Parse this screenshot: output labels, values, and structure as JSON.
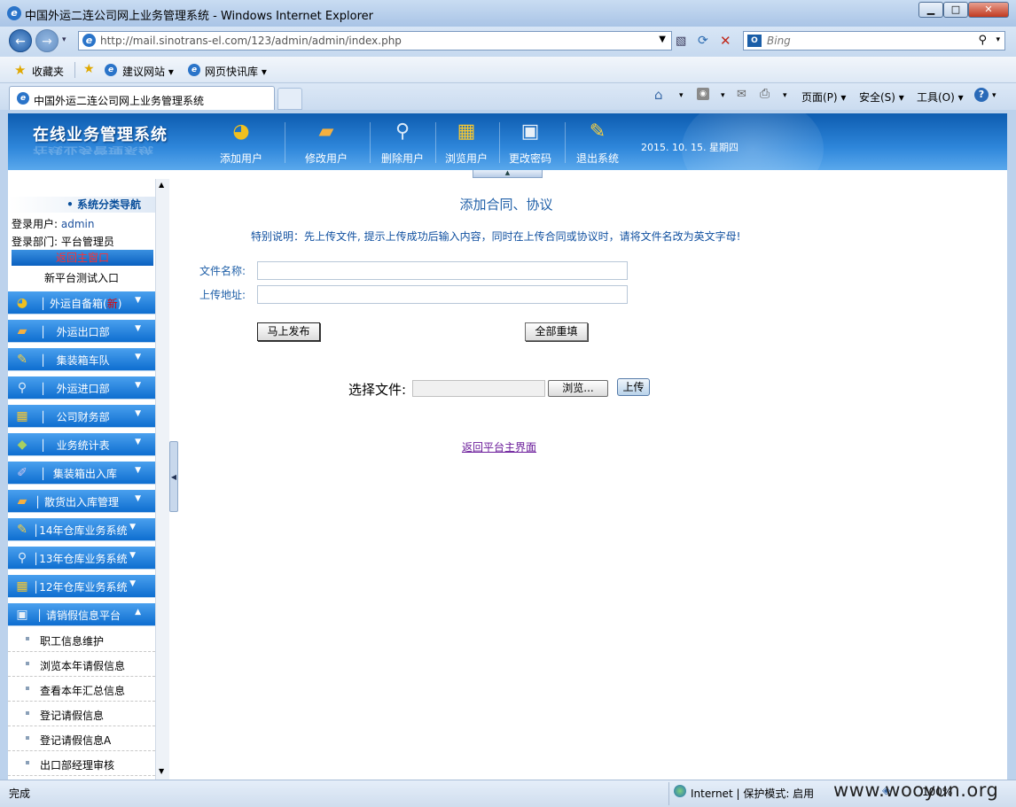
{
  "window": {
    "title": "中国外运二连公司网上业务管理系统 - Windows Internet Explorer"
  },
  "address": {
    "url": "http://mail.sinotrans-el.com/123/admin/admin/index.php",
    "search_placeholder": "Bing"
  },
  "favorites": {
    "label": "收藏夹",
    "items": [
      "建议网站 ▾",
      "网页快讯库 ▾"
    ]
  },
  "tab": {
    "title": "中国外运二连公司网上业务管理系统"
  },
  "commandbar": {
    "page": "页面(P) ▾",
    "safety": "安全(S) ▾",
    "tools": "工具(O) ▾"
  },
  "banner": {
    "system_name": "在线业务管理系统",
    "items": [
      {
        "label": "添加用户",
        "icon": "add-user-icon"
      },
      {
        "label": "修改用户",
        "icon": "books-icon"
      },
      {
        "label": "删除用户",
        "icon": "search-delete-icon"
      },
      {
        "label": "浏览用户",
        "icon": "cubes-icon"
      },
      {
        "label": "更改密码",
        "icon": "monitor-icon"
      },
      {
        "label": "退出系统",
        "icon": "note-icon"
      }
    ],
    "date": "2015. 10. 15. 星期四"
  },
  "sidebar": {
    "nav_title": "• 系统分类导航",
    "user_label": "登录用户:",
    "user_value": "admin",
    "dept_label": "登录部门:",
    "dept_value": "平台管理员",
    "back_main": "返回主窗口",
    "new_platform": "新平台测试入口",
    "menus": [
      {
        "pre": "外运自备箱(",
        "new": "新",
        "post": ")"
      },
      {
        "pre": "外运出口部",
        "new": "",
        "post": ""
      },
      {
        "pre": "集装箱车队",
        "new": "",
        "post": ""
      },
      {
        "pre": "外运进口部",
        "new": "",
        "post": ""
      },
      {
        "pre": "公司财务部",
        "new": "",
        "post": ""
      },
      {
        "pre": "业务统计表",
        "new": "",
        "post": ""
      },
      {
        "pre": "集装箱出入库",
        "new": "",
        "post": ""
      },
      {
        "pre": "散货出入库管理",
        "new": "",
        "post": ""
      },
      {
        "pre": "14年仓库业务系统",
        "new": "",
        "post": ""
      },
      {
        "pre": "13年仓库业务系统",
        "new": "",
        "post": ""
      },
      {
        "pre": "12年仓库业务系统",
        "new": "",
        "post": ""
      },
      {
        "pre": "请销假信息平台",
        "new": "",
        "post": ""
      }
    ],
    "subitems": [
      "职工信息维护",
      "浏览本年请假信息",
      "查看本年汇总信息",
      "登记请假信息",
      "登记请假信息A",
      "出口部经理审核"
    ]
  },
  "form": {
    "title": "添加合同、协议",
    "note": "特别说明：先上传文件, 提示上传成功后输入内容，同时在上传合同或协议时，请将文件名改为英文字母!",
    "file_name_label": "文件名称:",
    "upload_addr_label": "上传地址:",
    "publish_button": "马上发布",
    "reset_button": "全部重填",
    "choose_file_label": "选择文件:",
    "browse_button": "浏览...",
    "upload_button": "上传",
    "return_link": "返回平台主界面"
  },
  "status": {
    "left": "完成",
    "zone": "Internet | 保护模式: 启用",
    "zoom": "100%",
    "watermark": "www.wooyun.org"
  }
}
